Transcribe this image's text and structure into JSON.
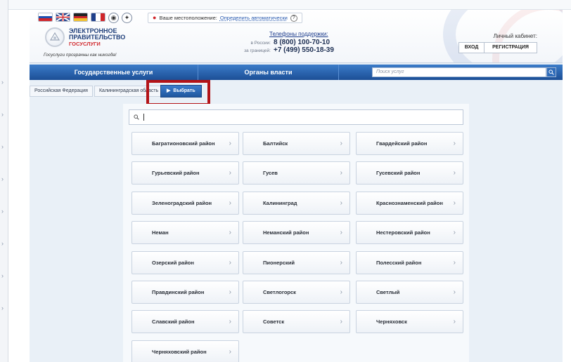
{
  "header": {
    "location_label": "Ваше местоположение:",
    "location_value": "Определить автоматически",
    "help": "?",
    "logo": {
      "line1": "ЭЛЕКТРОННОЕ",
      "line2": "ПРАВИТЕЛЬСТВО",
      "line3": "ГОСУСЛУГИ"
    },
    "tagline": "Госуслуги прозрачны как никогда!",
    "support": {
      "title": "Телефоны поддержки:",
      "russia_label": "в России:",
      "russia_number": "8 (800) 100-70-10",
      "abroad_label": "за границей:",
      "abroad_number": "+7 (499) 550-18-39"
    },
    "cabinet": {
      "title": "Личный кабинет:",
      "login": "ВХОД",
      "register": "РЕГИСТРАЦИЯ"
    }
  },
  "nav": {
    "items": [
      "Государственные услуги",
      "Органы власти"
    ],
    "search_placeholder": "Поиск услуг"
  },
  "breadcrumb": {
    "items": [
      "Российская Федерация",
      "Калининградская область"
    ],
    "select_button": "Выбрать"
  },
  "filter": {
    "placeholder": ""
  },
  "districts": [
    "Багратионовский район",
    "Балтийск",
    "Гвардейский район",
    "Гурьевский район",
    "Гусев",
    "Гусевский район",
    "Зеленоградский район",
    "Калининград",
    "Краснознаменский район",
    "Неман",
    "Неманский район",
    "Нестеровский район",
    "Озерский район",
    "Пионерский",
    "Полесский район",
    "Правдинский район",
    "Светлогорск",
    "Светлый",
    "Славский район",
    "Советск",
    "Черняховск",
    "Черняховский район"
  ],
  "icons": {
    "location": "location-pin-icon",
    "search": "search-icon",
    "chevron": "chevron-right-icon"
  },
  "colors": {
    "nav_blue": "#1c4f96",
    "highlight_red": "#b31317",
    "logo_red": "#d0262b"
  }
}
